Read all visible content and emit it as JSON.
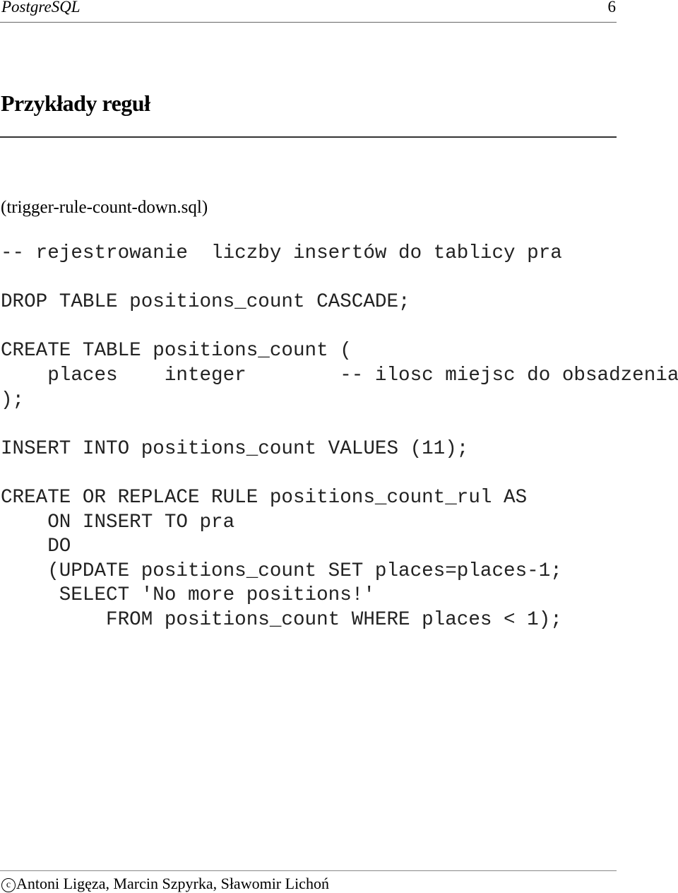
{
  "header": {
    "running_title": "PostgreSQL",
    "page_number": "6"
  },
  "section": {
    "title": "Przykłady reguł",
    "filename": "(trigger-rule-count-down.sql)"
  },
  "code_lines": [
    "-- rejestrowanie  liczby insertów do tablicy pra",
    "",
    "DROP TABLE positions_count CASCADE;",
    "",
    "CREATE TABLE positions_count (",
    "    places    integer        -- ilosc miejsc do obsadzenia",
    ");",
    "",
    "INSERT INTO positions_count VALUES (11);",
    "",
    "CREATE OR REPLACE RULE positions_count_rul AS",
    "    ON INSERT TO pra",
    "    DO",
    "    (UPDATE positions_count SET places=places-1;",
    "     SELECT 'No more positions!'",
    "         FROM positions_count WHERE places < 1);"
  ],
  "footer": {
    "copyright_symbol": "c",
    "authors": "Antoni Ligęza, Marcin Szpyrka, Sławomir Lichoń"
  }
}
